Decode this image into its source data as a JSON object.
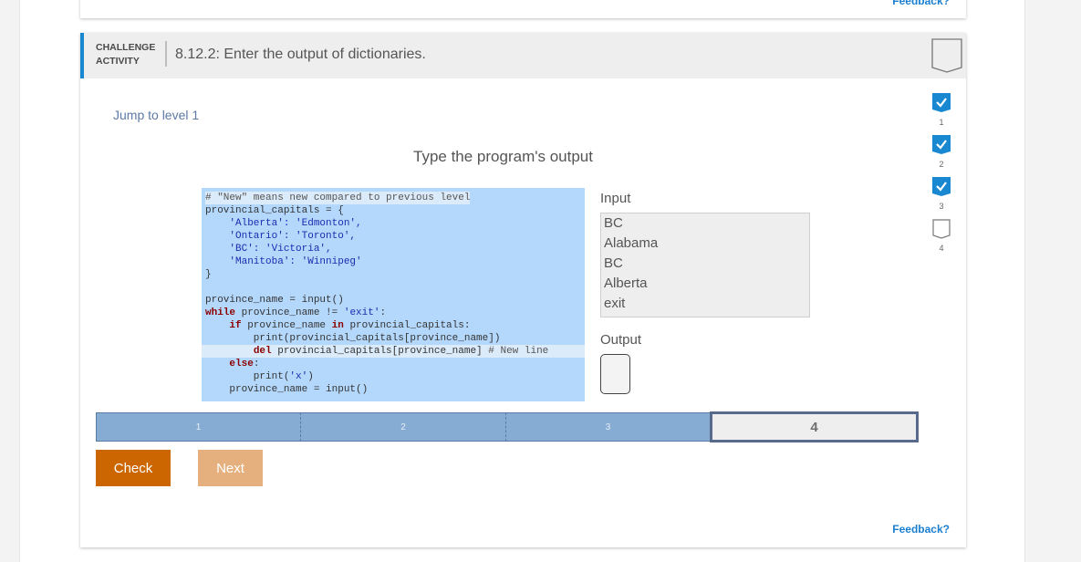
{
  "colors": {
    "accent_blue": "#1a88d1",
    "check_button": "#cc6600",
    "next_button": "#e6b07e",
    "level_complete": "#87acd3",
    "code_bg": "#b4d8fc"
  },
  "previous_card": {
    "feedback_label": "Feedback?"
  },
  "activity": {
    "type_label_line1": "CHALLENGE",
    "type_label_line2": "ACTIVITY",
    "title": "8.12.2: Enter the output of dictionaries.",
    "header_badge_icon": "completion-badge-empty-icon"
  },
  "jump_link": "Jump to level 1",
  "prompt": "Type the program's output",
  "code": {
    "lines": [
      "# \"New\" means new compared to previous level",
      "provincial_capitals = {",
      "    'Alberta': 'Edmonton',",
      "    'Ontario': 'Toronto',",
      "    'BC': 'Victoria',",
      "    'Manitoba': 'Winnipeg'",
      "}",
      "",
      "province_name = input()",
      "while province_name != 'exit':",
      "    if province_name in provincial_capitals:",
      "        print(provincial_capitals[province_name])",
      "        del provincial_capitals[province_name] # New line",
      "    else:",
      "        print('x')",
      "    province_name = input()"
    ]
  },
  "input": {
    "label": "Input",
    "values": [
      "BC",
      "Alabama",
      "BC",
      "Alberta",
      "exit"
    ]
  },
  "output": {
    "label": "Output",
    "value": ""
  },
  "levels": [
    {
      "label": "1",
      "status": "complete"
    },
    {
      "label": "2",
      "status": "complete"
    },
    {
      "label": "3",
      "status": "complete"
    },
    {
      "label": "4",
      "status": "current"
    }
  ],
  "buttons": {
    "check": "Check",
    "next": "Next"
  },
  "feedback_label": "Feedback?",
  "level_badges": [
    {
      "number": "1",
      "completed": true,
      "icon": "check-badge-icon"
    },
    {
      "number": "2",
      "completed": true,
      "icon": "check-badge-icon"
    },
    {
      "number": "3",
      "completed": true,
      "icon": "check-badge-icon"
    },
    {
      "number": "4",
      "completed": false,
      "icon": "empty-badge-icon"
    }
  ]
}
